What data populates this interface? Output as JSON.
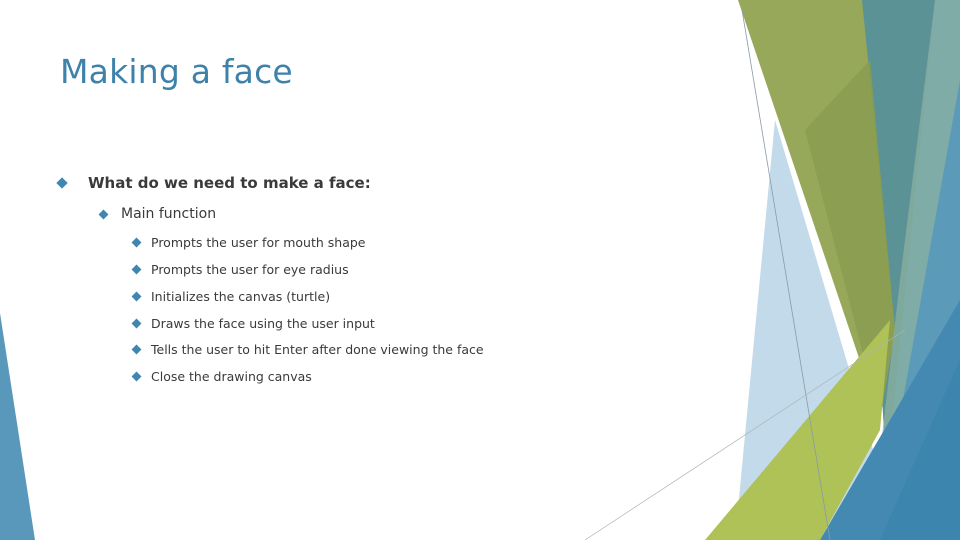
{
  "slide": {
    "title": "Making a face",
    "level1": "What do we need to make a face:",
    "level2": "Main function",
    "items": [
      "Prompts the user for mouth shape",
      "Prompts the user for eye radius",
      "Initializes the canvas (turtle)",
      "Draws the face using the user input",
      "Tells the user to hit Enter after done viewing the face",
      "Close the drawing canvas"
    ]
  },
  "colors": {
    "title": "#3e82aa",
    "bullet": "#3f86b0",
    "text": "#3a3a3a",
    "olive": "#98a85a",
    "lime": "#aec257",
    "teal": "#5a9296",
    "blue": "#3f88b2",
    "pale_blue": "#b8d4e6"
  }
}
